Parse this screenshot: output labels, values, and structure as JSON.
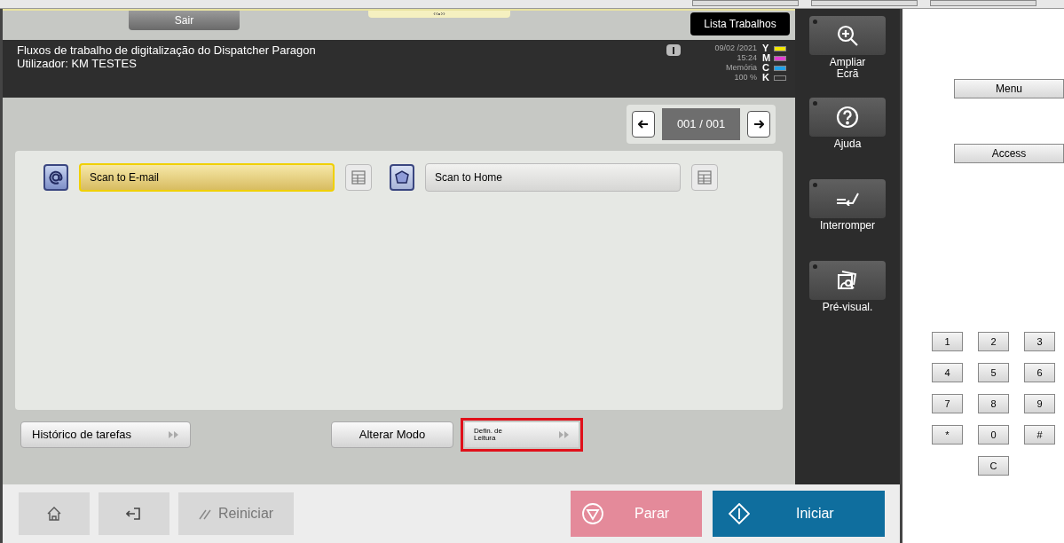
{
  "top_bar": {
    "exit_label": "Sair",
    "handle": "‹‹•››",
    "job_list": "Lista Trabalhos"
  },
  "header": {
    "title": "Fluxos de trabalho de digitalização do Dispatcher Paragon",
    "user": "Utilizador: KM TESTES",
    "date": "09/02 /2021",
    "time": "15:24",
    "memory_label": "Memória",
    "memory_value": "100 %",
    "toners": [
      {
        "letter": "Y",
        "color": "#f2e600"
      },
      {
        "letter": "M",
        "color": "#e040d0"
      },
      {
        "letter": "C",
        "color": "#20a0e8"
      },
      {
        "letter": "K",
        "color": "#303030"
      }
    ]
  },
  "pager": {
    "value": "001 / 001"
  },
  "workflows": [
    {
      "kind": "email",
      "label": "Scan to E-mail",
      "selected": true
    },
    {
      "kind": "home",
      "label": "Scan to Home",
      "selected": false
    }
  ],
  "bottom_buttons": [
    {
      "label": "Histórico de tarefas",
      "arrow": true,
      "highlighted": false
    },
    {
      "label": "Alterar Modo",
      "arrow": false,
      "highlighted": false
    },
    {
      "label": "Defin. de\nLeitura",
      "arrow": true,
      "highlighted": true
    }
  ],
  "side_buttons": [
    {
      "kind": "zoom",
      "label": "Ampliar\nEcrã"
    },
    {
      "kind": "help",
      "label": "Ajuda"
    },
    {
      "kind": "interrupt",
      "label": "Interromper"
    },
    {
      "kind": "preview",
      "label": "Pré-visual."
    }
  ],
  "footer": {
    "reset": "Reiniciar",
    "stop": "Parar",
    "start": "Iniciar"
  },
  "panel": {
    "buttons": [
      "Menu",
      "Access"
    ],
    "keys": [
      [
        "1",
        "2",
        "3"
      ],
      [
        "4",
        "5",
        "6"
      ],
      [
        "7",
        "8",
        "9"
      ],
      [
        "*",
        "0",
        "#"
      ],
      [
        "C"
      ]
    ]
  }
}
